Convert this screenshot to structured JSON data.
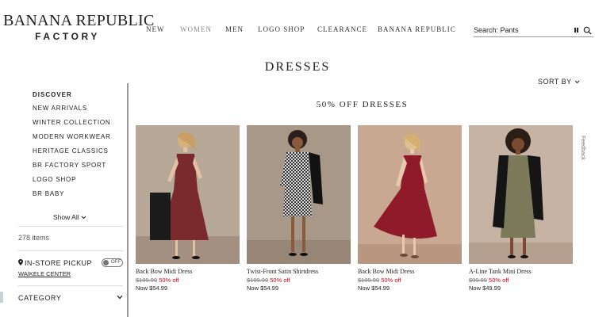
{
  "header": {
    "logo_line1": "BANANA REPUBLIC",
    "logo_line2": "FACTORY",
    "nav": [
      "NEW",
      "WOMEN",
      "MEN",
      "LOGO SHOP",
      "CLEARANCE",
      "BANANA REPUBLIC"
    ],
    "search_placeholder": "Search: Pants"
  },
  "page": {
    "title": "DRESSES",
    "sort_label": "SORT BY",
    "promo_heading": "50% OFF DRESSES",
    "feedback_label": "Feedback"
  },
  "sidebar": {
    "heading": "DISCOVER",
    "links": [
      "NEW ARRIVALS",
      "WINTER COLLECTION",
      "MODERN WORKWEAR",
      "HERITAGE CLASSICS",
      "BR FACTORY SPORT",
      "LOGO SHOP",
      "BR BABY"
    ],
    "show_all": "Show All",
    "items_count": "278 items",
    "pickup_label": "IN-STORE PICKUP",
    "pickup_toggle": "OFF",
    "store_name": "WAIKELE CENTER",
    "category_label": "CATEGORY"
  },
  "products": [
    {
      "name": "Back Bow Midi Dress",
      "orig_price": "$109.99",
      "discount": "50% off",
      "now_price": "Now $54.99",
      "dress_color": "#7a2a2c",
      "bg_color": "#b8a898"
    },
    {
      "name": "Twist-Front Satin Shirtdress",
      "orig_price": "$109.99",
      "discount": "50% off",
      "now_price": "Now $54.99",
      "dress_color": "#8a8a8a",
      "bg_color": "#a89888"
    },
    {
      "name": "Back Bow Midi Dress",
      "orig_price": "$109.99",
      "discount": "50% off",
      "now_price": "Now $54.99",
      "dress_color": "#8e1a2a",
      "bg_color": "#c9a892"
    },
    {
      "name": "A-Line Tank Mini Dress",
      "orig_price": "$99.99",
      "discount": "50% off",
      "now_price": "Now $49.99",
      "dress_color": "#7d7a5c",
      "bg_color": "#c7b3a3"
    }
  ],
  "colors": {
    "sale_red": "#d0021b",
    "text_dark": "#222222"
  }
}
